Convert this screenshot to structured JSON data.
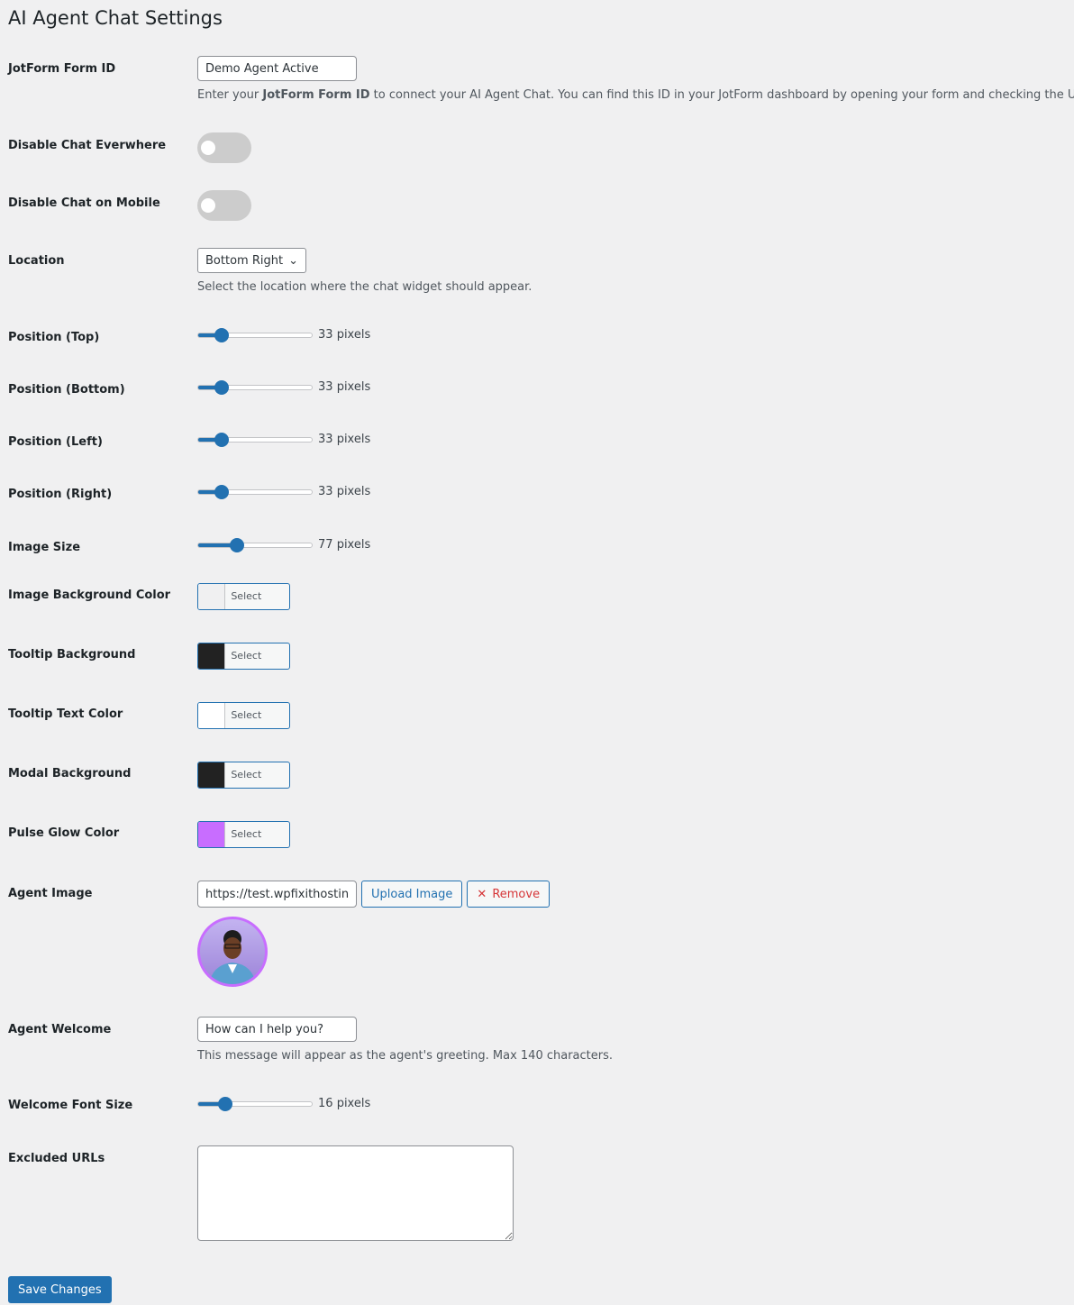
{
  "title": "AI Agent Chat Settings",
  "form_id": {
    "label": "JotForm Form ID",
    "value": "Demo Agent Active",
    "desc_pre": "Enter your ",
    "desc_bold": "JotForm Form ID",
    "desc_post": " to connect your AI Agent Chat. You can find this ID in your JotForm dashboard by opening your form and checking the URL."
  },
  "disable_everywhere": {
    "label": "Disable Chat Everwhere",
    "on": false
  },
  "disable_mobile": {
    "label": "Disable Chat on Mobile",
    "on": false
  },
  "location": {
    "label": "Location",
    "value": "Bottom Right",
    "desc": "Select the location where the chat widget should appear."
  },
  "sliders": [
    {
      "label": "Position (Top)",
      "value": "33",
      "unit": "pixels"
    },
    {
      "label": "Position (Bottom)",
      "value": "33",
      "unit": "pixels"
    },
    {
      "label": "Position (Left)",
      "value": "33",
      "unit": "pixels"
    },
    {
      "label": "Position (Right)",
      "value": "33",
      "unit": "pixels"
    },
    {
      "label": "Image Size",
      "value": "77",
      "unit": "pixels"
    }
  ],
  "colors": [
    {
      "label": "Image Background Color",
      "color": "#f0f0f1",
      "button": "Select Color"
    },
    {
      "label": "Tooltip Background",
      "color": "#222222",
      "button": "Select Color"
    },
    {
      "label": "Tooltip Text Color",
      "color": "#ffffff",
      "button": "Select Color"
    },
    {
      "label": "Modal Background",
      "color": "#222222",
      "button": "Select Color"
    },
    {
      "label": "Pulse Glow Color",
      "color": "#c86dff",
      "button": "Select Color"
    }
  ],
  "agent_image": {
    "label": "Agent Image",
    "value": "https://test.wpfixithosting",
    "upload": "Upload Image",
    "remove": "Remove"
  },
  "welcome": {
    "label": "Agent Welcome",
    "value": "How can I help you?",
    "desc": "This message will appear as the agent's greeting. Max 140 characters."
  },
  "font_size": {
    "label": "Welcome Font Size",
    "value": "16",
    "unit": "pixels"
  },
  "excluded": {
    "label": "Excluded URLs",
    "value": ""
  },
  "save": "Save Changes"
}
